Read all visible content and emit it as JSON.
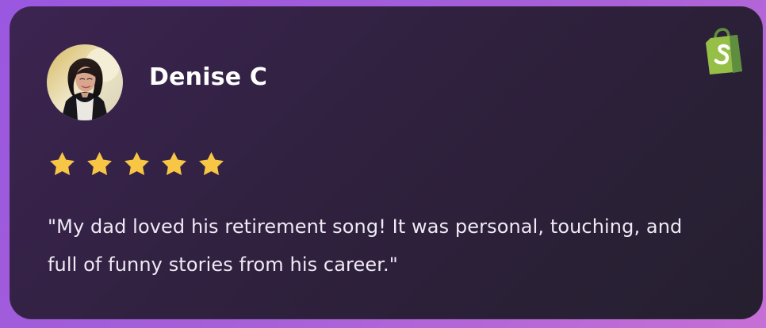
{
  "reviewer": {
    "name": "Denise C",
    "avatar_alt": "",
    "rating": 5,
    "review_text": "\"My dad loved his retirement song! It was personal, touching, and full of funny stories from his career.\""
  },
  "theme": {
    "background_gradient": [
      "#9a57e0",
      "#c66fd6"
    ],
    "card_gradient": [
      "#3c2451",
      "#251f2f"
    ],
    "star_color": "#f7c645",
    "shopify_green": "#95bf47",
    "shopify_green_dark": "#5e8e3e"
  },
  "icons": {
    "avatar": "portrait-avatar",
    "shopify": "shopify-bag-icon",
    "stars": [
      "star-icon",
      "star-icon",
      "star-icon",
      "star-icon",
      "star-icon"
    ]
  }
}
